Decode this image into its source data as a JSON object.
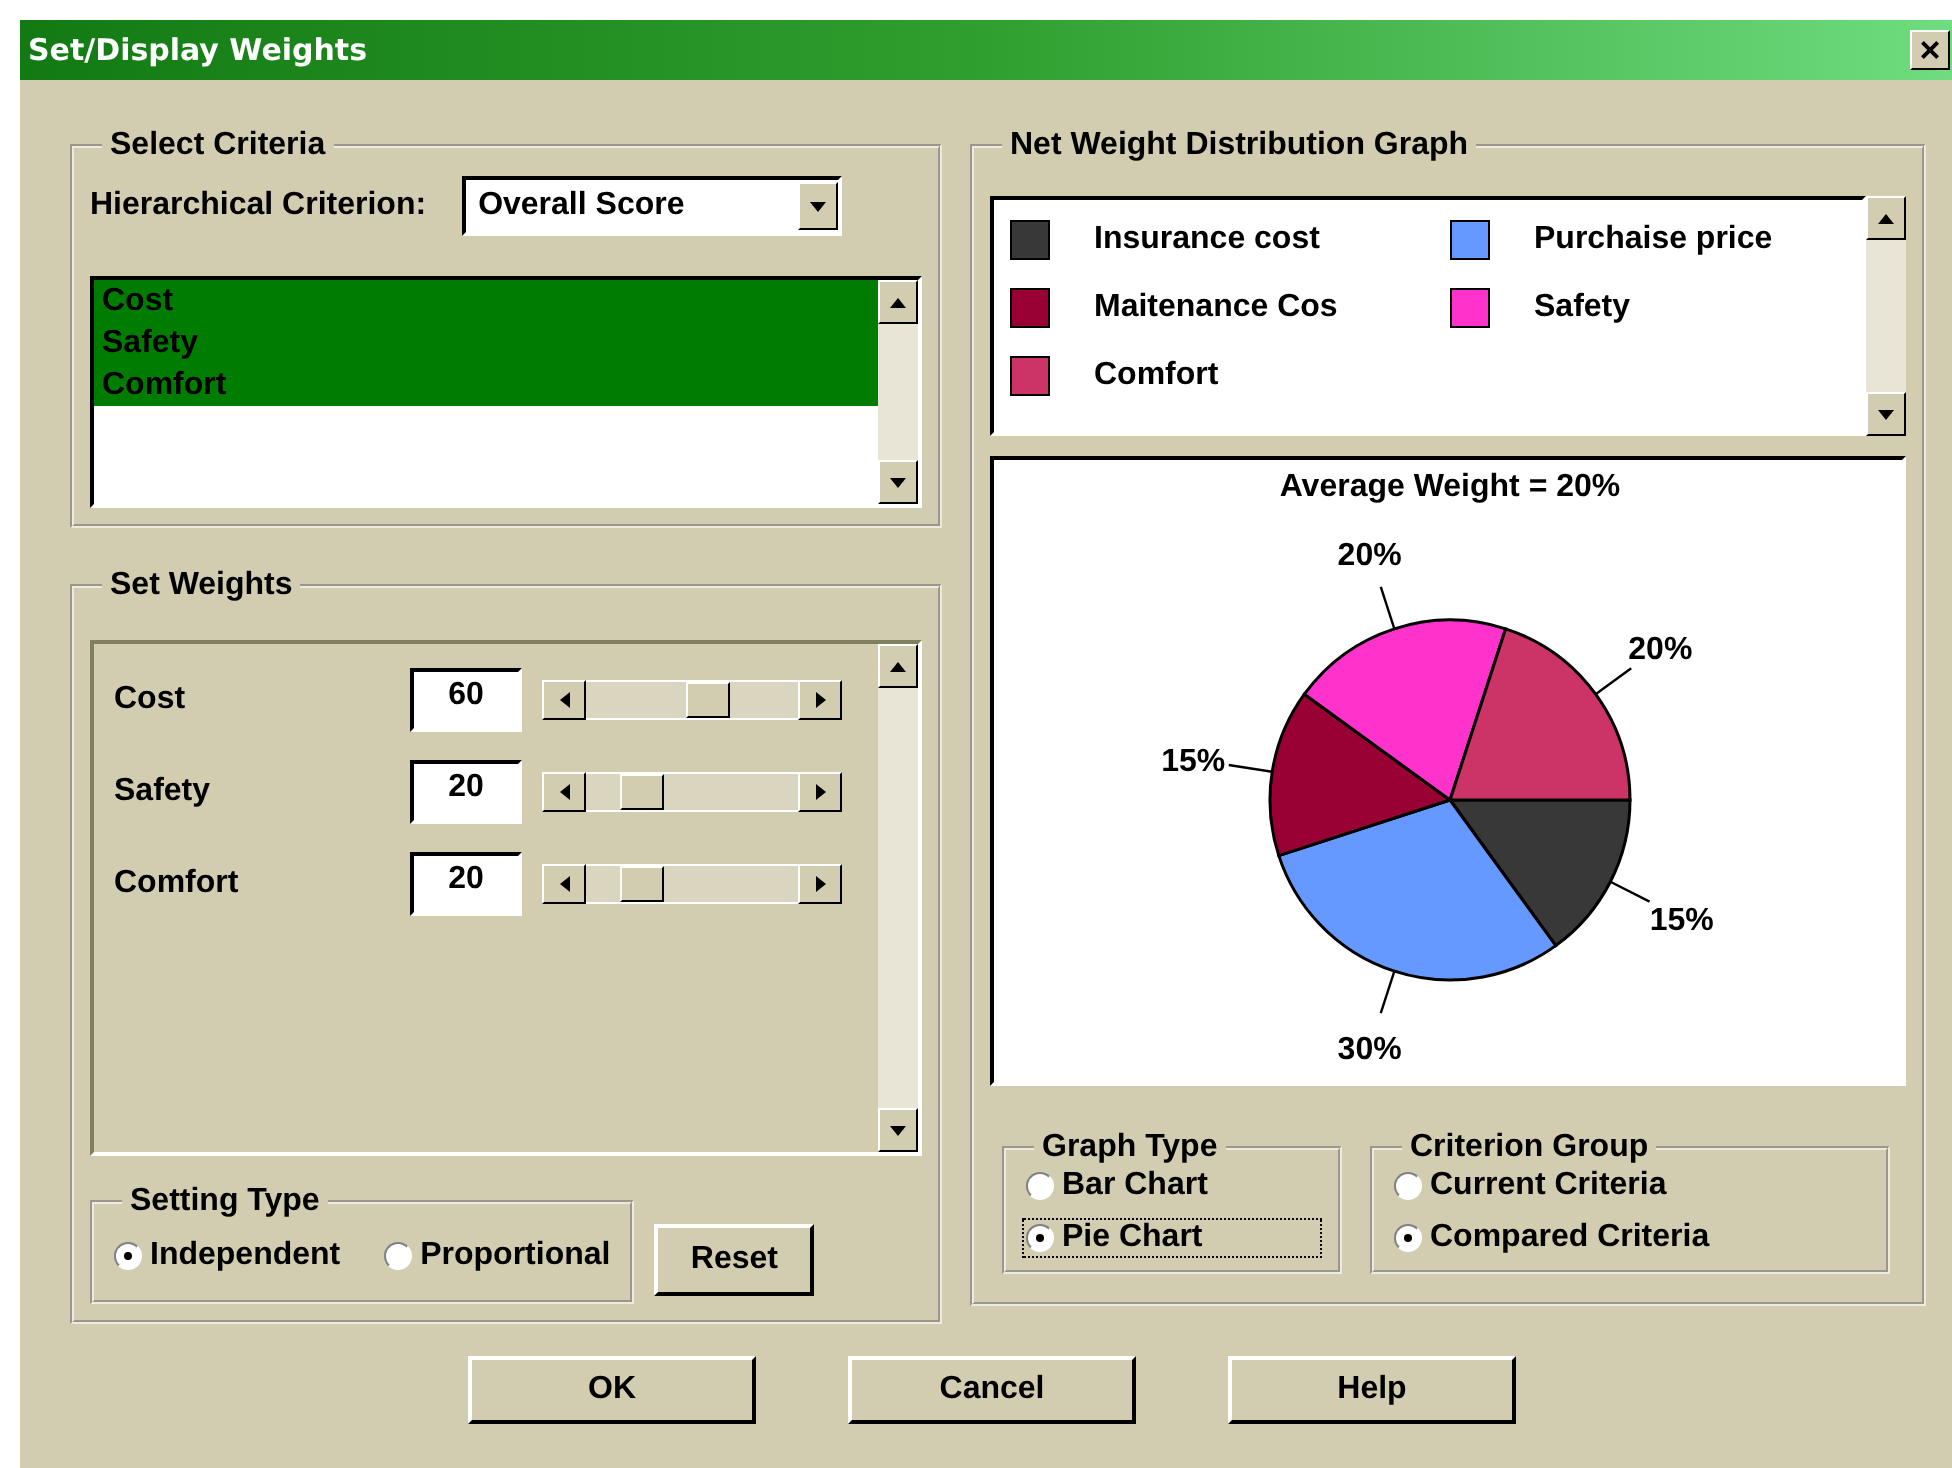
{
  "window": {
    "title": "Set/Display Weights",
    "close": "×"
  },
  "select_criteria": {
    "title": "Select Criteria",
    "criterion_label": "Hierarchical Criterion:",
    "criterion_value": "Overall Score",
    "items": [
      {
        "label": "Cost",
        "selected": true
      },
      {
        "label": "Safety",
        "selected": true
      },
      {
        "label": "Comfort",
        "selected": true
      }
    ]
  },
  "set_weights": {
    "title": "Set Weights",
    "rows": [
      {
        "name": "Cost",
        "value": "60",
        "level": 0.6
      },
      {
        "name": "Safety",
        "value": "20",
        "level": 0.2
      },
      {
        "name": "Comfort",
        "value": "20",
        "level": 0.2
      }
    ],
    "setting_type": {
      "title": "Setting Type",
      "options": [
        {
          "label": "Independent",
          "selected": true,
          "focused": false
        },
        {
          "label": "Proportional",
          "selected": false,
          "focused": false
        }
      ]
    },
    "reset": "Reset"
  },
  "graph": {
    "title": "Net Weight Distribution Graph",
    "legend": [
      {
        "label": "Insurance cost",
        "color": "#383838"
      },
      {
        "label": "Purchaise price",
        "color": "#6699ff"
      },
      {
        "label": "Maitenance Cos",
        "color": "#990033"
      },
      {
        "label": "Safety",
        "color": "#ff33cc"
      },
      {
        "label": "Comfort",
        "color": "#cc3366"
      }
    ],
    "chart_data": {
      "type": "pie",
      "title": "Average Weight = 20%",
      "values": [
        15,
        30,
        15,
        20,
        20
      ],
      "value_labels": [
        "15%",
        "30%",
        "15%",
        "20%",
        "20%"
      ]
    },
    "graph_type": {
      "title": "Graph Type",
      "options": [
        {
          "label": "Bar Chart",
          "selected": false,
          "focused": false
        },
        {
          "label": "Pie Chart",
          "selected": true,
          "focused": true
        }
      ]
    },
    "criterion_group": {
      "title": "Criterion Group",
      "options": [
        {
          "label": "Current Criteria",
          "selected": false,
          "focused": false
        },
        {
          "label": "Compared Criteria",
          "selected": true,
          "focused": false
        }
      ]
    }
  },
  "buttons": [
    "OK",
    "Cancel",
    "Help"
  ]
}
